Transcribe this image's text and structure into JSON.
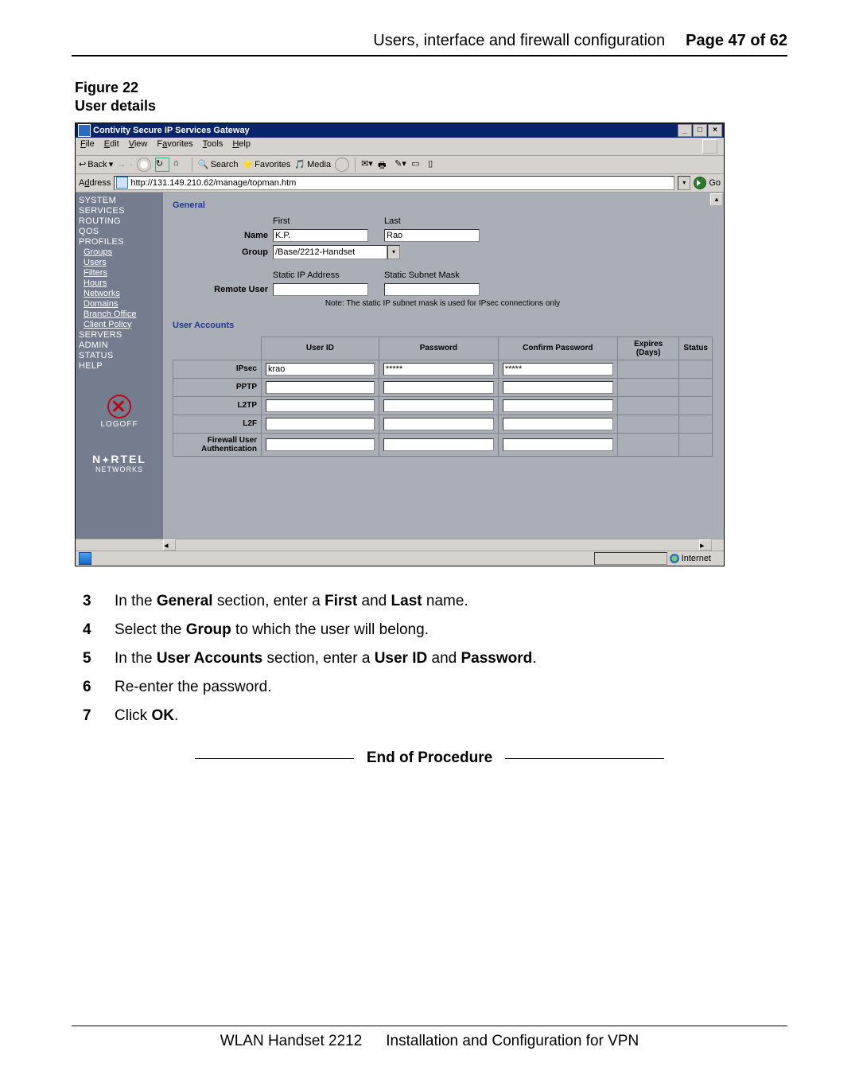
{
  "header": {
    "section_title": "Users, interface and firewall configuration",
    "page_label": "Page 47 of 62"
  },
  "figure": {
    "num": "Figure 22",
    "title": "User details"
  },
  "browser": {
    "window_title": "Contivity Secure IP Services Gateway",
    "menu": {
      "file": "File",
      "edit": "Edit",
      "view": "View",
      "favorites": "Favorites",
      "tools": "Tools",
      "help": "Help"
    },
    "toolbar": {
      "back": "Back",
      "search": "Search",
      "favorites": "Favorites",
      "media": "Media"
    },
    "address_label": "Address",
    "url": "http://131.149.210.62/manage/topman.htm",
    "go": "Go"
  },
  "sidebar": {
    "system": "SYSTEM",
    "services": "SERVICES",
    "routing": "ROUTING",
    "qos": "QOS",
    "profiles": "PROFILES",
    "groups": "Groups",
    "users": "Users",
    "filters": "Filters",
    "hours": "Hours",
    "networks": "Networks",
    "domains": "Domains",
    "branch": "Branch Office",
    "client_policy": "Client Policy",
    "servers": "SERVERS",
    "admin": "ADMIN",
    "status": "STATUS",
    "help": "HELP",
    "logoff": "LOGOFF",
    "company_top": "NORTEL",
    "company_sub": "NETWORKS"
  },
  "general": {
    "heading": "General",
    "first_label": "First",
    "last_label": "Last",
    "name_label": "Name",
    "first_value": "K.P.",
    "last_value": "Rao",
    "group_label": "Group",
    "group_value": "/Base/2212-Handset",
    "static_ip_label": "Static IP Address",
    "subnet_label": "Static Subnet Mask",
    "remote_user_label": "Remote User",
    "note": "Note: The static IP subnet mask is used for IPsec connections only"
  },
  "accounts": {
    "heading": "User Accounts",
    "cols": {
      "uid": "User ID",
      "pwd": "Password",
      "confirm": "Confirm Password",
      "expires": "Expires (Days)",
      "status": "Status"
    },
    "rows": {
      "ipsec": {
        "label": "IPsec",
        "uid": "krao",
        "pwd": "*****",
        "confirm": "*****"
      },
      "pptp": {
        "label": "PPTP"
      },
      "l2tp": {
        "label": "L2TP"
      },
      "l2f": {
        "label": "L2F"
      },
      "fw": {
        "label": "Firewall User Authentication"
      }
    }
  },
  "statusbar": {
    "zone": "Internet"
  },
  "steps": {
    "s3": {
      "n": "3",
      "html": "In the <b>General</b> section, enter a <b>First</b> and <b>Last</b> name."
    },
    "s4": {
      "n": "4",
      "html": "Select the <b>Group</b> to which the user will belong."
    },
    "s5": {
      "n": "5",
      "html": "In the <b>User Accounts</b> section, enter a <b>User ID</b> and <b>Password</b>."
    },
    "s6": {
      "n": "6",
      "html": "Re-enter the password."
    },
    "s7": {
      "n": "7",
      "html": "Click <b>OK</b>."
    }
  },
  "end_of_procedure": "End of Procedure",
  "footer": {
    "product": "WLAN Handset 2212",
    "doc": "Installation and Configuration for VPN"
  }
}
